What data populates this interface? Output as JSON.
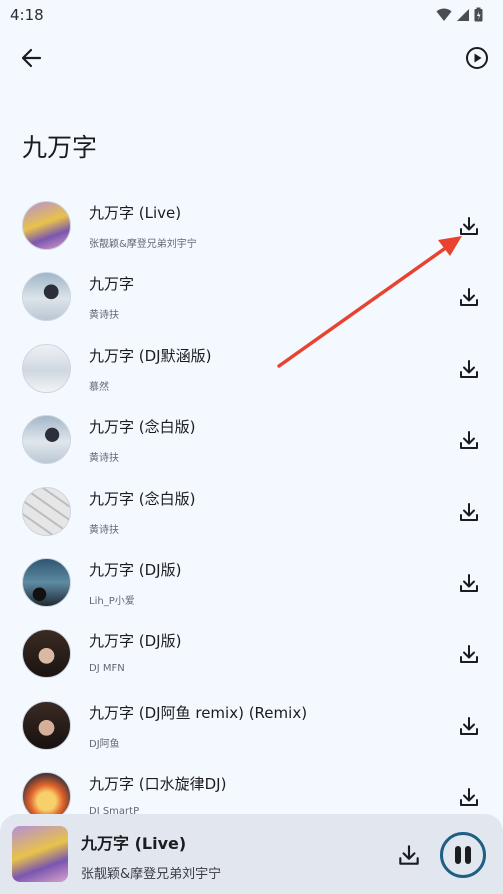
{
  "status_bar": {
    "time": "4:18"
  },
  "page": {
    "title": "九万字"
  },
  "songs": [
    {
      "title": "九万字 (Live)",
      "artist": "张靓颖&摩登兄弟刘宇宁"
    },
    {
      "title": "九万字",
      "artist": "黄诗扶"
    },
    {
      "title": "九万字 (DJ默涵版)",
      "artist": "慕然"
    },
    {
      "title": "九万字 (念白版)",
      "artist": "黄诗扶"
    },
    {
      "title": "九万字 (念白版)",
      "artist": "黄诗扶"
    },
    {
      "title": "九万字 (DJ版)",
      "artist": "Lih_P小爱"
    },
    {
      "title": "九万字 (DJ版)",
      "artist": "DJ MFN"
    },
    {
      "title": "九万字 (DJ阿鱼 remix) (Remix)",
      "artist": "DJ阿鱼"
    },
    {
      "title": "九万字 (口水旋律DJ)",
      "artist": "DJ SmartP"
    }
  ],
  "now_playing": {
    "title": "九万字 (Live)",
    "artist": "张靓颖&摩登兄弟刘宇宁"
  },
  "colors": {
    "annotation_arrow": "#e8432f",
    "pause_ring": "#1f5f84",
    "background": "#f4f9ff"
  }
}
